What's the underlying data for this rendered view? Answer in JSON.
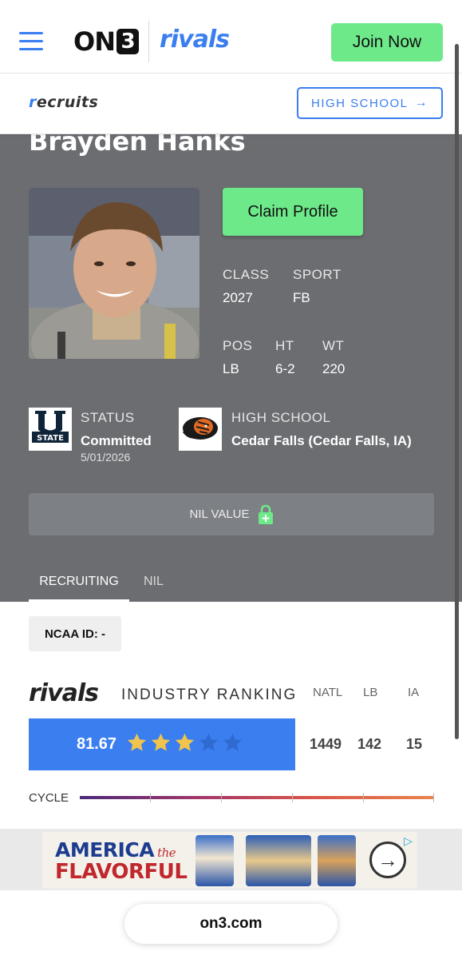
{
  "header": {
    "logo_on3_text": "ON",
    "logo_on3_digit": "3",
    "logo_rivals": "rivals",
    "join_label": "Join Now"
  },
  "subheader": {
    "recruits_r": "r",
    "recruits_rest": "ecruits",
    "high_school_label": "HIGH SCHOOL",
    "high_school_arrow": "→"
  },
  "profile": {
    "name": "Brayden Hanks",
    "claim_label": "Claim Profile",
    "class_label": "CLASS",
    "class_value": "2027",
    "sport_label": "SPORT",
    "sport_value": "FB",
    "pos_label": "POS",
    "pos_value": "LB",
    "ht_label": "HT",
    "ht_value": "6-2",
    "wt_label": "WT",
    "wt_value": "220",
    "status_label": "STATUS",
    "status_value": "Committed",
    "status_date": "5/01/2026",
    "school_logo_text": "STATE",
    "high_school_label": "HIGH SCHOOL",
    "high_school_value": "Cedar Falls (Cedar Falls, IA)",
    "nil_label": "NIL VALUE"
  },
  "tabs": [
    {
      "label": "RECRUITING",
      "active": true
    },
    {
      "label": "NIL",
      "active": false
    }
  ],
  "ncaa": {
    "label": "NCAA ID:  -"
  },
  "ranking": {
    "brand": "rivals",
    "title": "INDUSTRY RANKING",
    "columns": [
      "NATL",
      "LB",
      "IA"
    ],
    "score": "81.67",
    "stars_filled": 3,
    "stars_total": 5,
    "values": [
      "1449",
      "142",
      "15"
    ],
    "cycle_label": "CYCLE"
  },
  "ad": {
    "line1": "AMERICA",
    "line1_the": "the",
    "line2": "FLAVORFUL"
  },
  "footer": {
    "url": "on3.com"
  },
  "colors": {
    "accent_blue": "#3a7ef0",
    "cta_green": "#6ee98a",
    "panel_gray": "#6b6d71",
    "star_gold": "#f0c44c"
  }
}
